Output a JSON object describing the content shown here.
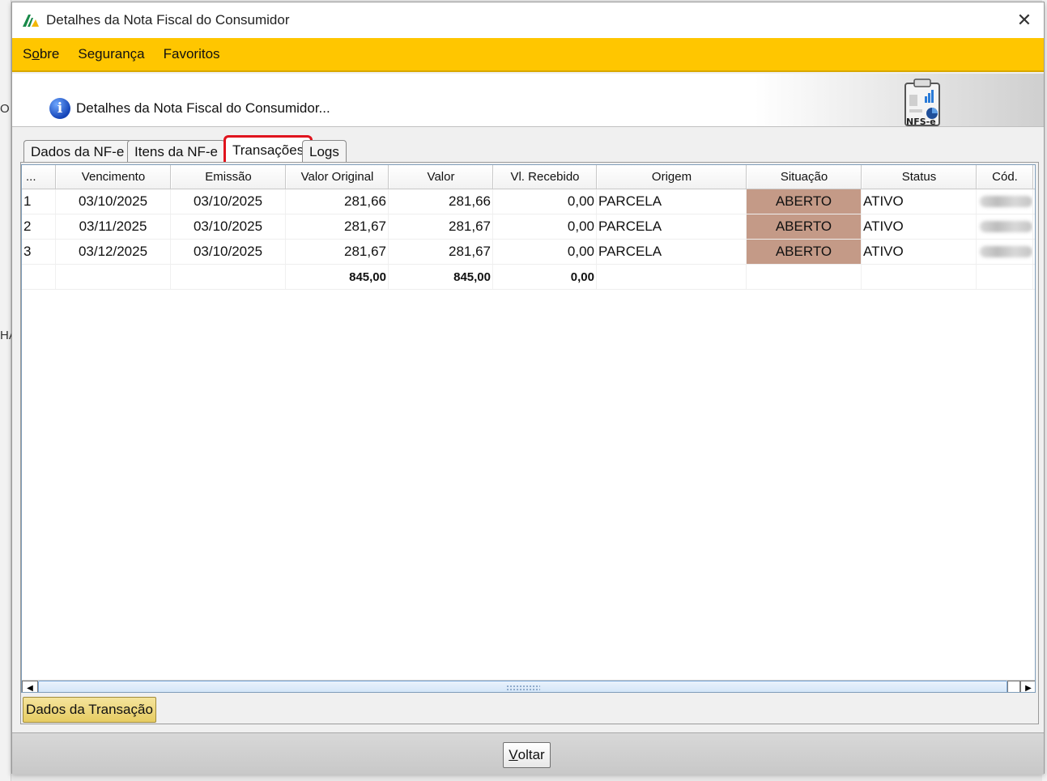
{
  "background": {
    "fragments": [
      "O",
      "HA"
    ]
  },
  "window": {
    "title": "Detalhes da Nota Fiscal do Consumidor",
    "close_glyph": "✕"
  },
  "menu": {
    "items": [
      {
        "pre": "S",
        "ul": "o",
        "post": "bre"
      },
      {
        "pre": "",
        "ul": "",
        "post": "Segurança"
      },
      {
        "pre": "",
        "ul": "",
        "post": "Favoritos"
      }
    ]
  },
  "header": {
    "text": "Detalhes da Nota Fiscal do Consumidor...",
    "icon_label": "NFS-e"
  },
  "tabs": [
    {
      "label": "Dados da NF-e"
    },
    {
      "label": "Itens da NF-e"
    },
    {
      "label": "Transações",
      "active": true
    },
    {
      "label": "Logs"
    }
  ],
  "table": {
    "columns": [
      "...",
      "Vencimento",
      "Emissão",
      "Valor Original",
      "Valor",
      "Vl. Recebido",
      "Origem",
      "Situação",
      "Status",
      "Cód."
    ],
    "rows": [
      [
        "1",
        "03/10/2025",
        "03/10/2025",
        "281,66",
        "281,66",
        "0,00",
        "PARCELA",
        "ABERTO",
        "ATIVO"
      ],
      [
        "2",
        "03/11/2025",
        "03/10/2025",
        "281,67",
        "281,67",
        "0,00",
        "PARCELA",
        "ABERTO",
        "ATIVO"
      ],
      [
        "3",
        "03/12/2025",
        "03/10/2025",
        "281,67",
        "281,67",
        "0,00",
        "PARCELA",
        "ABERTO",
        "ATIVO"
      ]
    ],
    "totals": {
      "valor_original": "845,00",
      "valor": "845,00",
      "vl_recebido": "0,00"
    },
    "situacao_color": "#c49a87"
  },
  "scrollbar": {
    "left_arrow": "◀",
    "right_arrow": "▶"
  },
  "buttons": {
    "dados_transacao": "Dados da Transação",
    "voltar": {
      "ul": "V",
      "post": "oltar"
    }
  },
  "colors": {
    "menubar": "#ffc600",
    "highlight": "#e0141e",
    "button_gold": "#e6cc62"
  }
}
